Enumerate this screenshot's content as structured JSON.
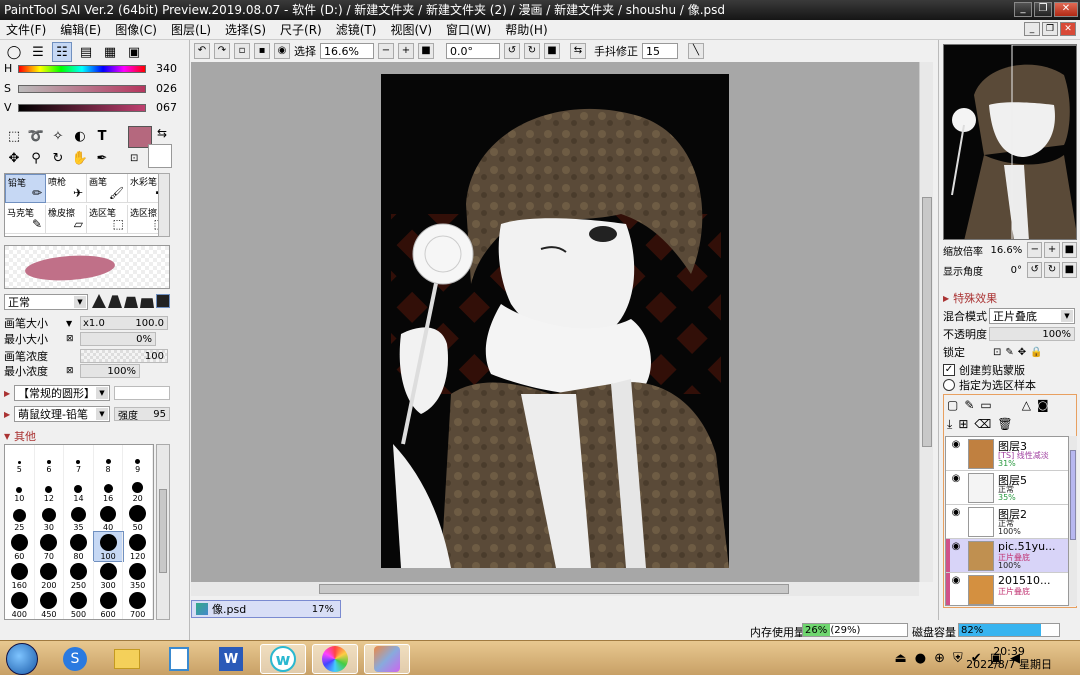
{
  "window": {
    "title": "PaintTool SAI Ver.2 (64bit) Preview.2019.08.07 - 软件 (D:) / 新建文件夹 / 新建文件夹 (2) / 漫画 / 新建文件夹 / shoushu / 像.psd"
  },
  "menu": [
    "文件(F)",
    "编辑(E)",
    "图像(C)",
    "图层(L)",
    "选择(S)",
    "尺子(R)",
    "滤镜(T)",
    "视图(V)",
    "窗口(W)",
    "帮助(H)"
  ],
  "color": {
    "h_label": "H",
    "h_value": "340",
    "s_label": "S",
    "s_value": "026",
    "v_label": "V",
    "v_value": "067",
    "primary": "#b5687e"
  },
  "brushes": [
    {
      "label": "铅笔",
      "icon": "pencil-icon",
      "selected": true
    },
    {
      "label": "喷枪",
      "icon": "airbrush-icon"
    },
    {
      "label": "画笔",
      "icon": "brush-icon"
    },
    {
      "label": "水彩笔",
      "icon": "watercolor-icon"
    },
    {
      "label": "马克笔",
      "icon": "marker-icon"
    },
    {
      "label": "橡皮擦",
      "icon": "eraser-icon"
    },
    {
      "label": "选区笔",
      "icon": "selection-pen-icon"
    },
    {
      "label": "选区擦",
      "icon": "selection-eraser-icon"
    }
  ],
  "brush_settings": {
    "blend_mode": "正常",
    "size_label": "画笔大小",
    "size_mult": "x1.0",
    "size_value": "100.0",
    "min_size_label": "最小大小",
    "min_size_value": "0%",
    "density_label": "画笔浓度",
    "density_value": "100",
    "min_density_label": "最小浓度",
    "min_density_value": "100%",
    "shape_label": "【常规的圆形】",
    "texture_label": "萌鼠纹理-铅笔",
    "strength_label": "强度",
    "strength_value": "95",
    "other_label": "其他"
  },
  "size_presets": [
    {
      "v": "5",
      "d": 3
    },
    {
      "v": "6",
      "d": 4
    },
    {
      "v": "7",
      "d": 4
    },
    {
      "v": "8",
      "d": 5
    },
    {
      "v": "9",
      "d": 5
    },
    {
      "v": "10",
      "d": 6
    },
    {
      "v": "12",
      "d": 7
    },
    {
      "v": "14",
      "d": 8
    },
    {
      "v": "16",
      "d": 9
    },
    {
      "v": "20",
      "d": 11
    },
    {
      "v": "25",
      "d": 13
    },
    {
      "v": "30",
      "d": 14
    },
    {
      "v": "35",
      "d": 15
    },
    {
      "v": "40",
      "d": 16
    },
    {
      "v": "50",
      "d": 17
    },
    {
      "v": "60",
      "d": 17
    },
    {
      "v": "70",
      "d": 17
    },
    {
      "v": "80",
      "d": 17
    },
    {
      "v": "100",
      "d": 17,
      "sel": true
    },
    {
      "v": "120",
      "d": 17
    },
    {
      "v": "160",
      "d": 17
    },
    {
      "v": "200",
      "d": 17
    },
    {
      "v": "250",
      "d": 17
    },
    {
      "v": "300",
      "d": 17
    },
    {
      "v": "350",
      "d": 17
    },
    {
      "v": "400",
      "d": 17
    },
    {
      "v": "450",
      "d": 17
    },
    {
      "v": "500",
      "d": 17
    },
    {
      "v": "600",
      "d": 17
    },
    {
      "v": "700",
      "d": 17
    }
  ],
  "canvas_toolbar": {
    "select_label": "选择",
    "zoom": "16.6%",
    "angle": "0.0°",
    "stabilizer_label": "手抖修正",
    "stabilizer_value": "15"
  },
  "navigator": {
    "zoom_label": "缩放倍率",
    "zoom_value": "16.6%",
    "angle_label": "显示角度",
    "angle_value": "0°"
  },
  "layer_panel": {
    "effects_label": "特殊效果",
    "blend_label": "混合模式",
    "blend_value": "正片叠底",
    "opacity_label": "不透明度",
    "opacity_value": "100%",
    "lock_label": "锁定",
    "clip_label": "创建剪贴蒙版",
    "select_src_label": "指定为选区样本"
  },
  "layers": [
    {
      "name": "图层3",
      "mode": "[TS] 线性减淡",
      "opacity": "31%",
      "thumb": "#c08040"
    },
    {
      "name": "图层5",
      "mode": "正常",
      "opacity": "35%",
      "thumb": "#f4f4f4"
    },
    {
      "name": "图层2",
      "mode": "正常",
      "opacity": "100%",
      "thumb": "#ffffff"
    },
    {
      "name": "pic.51yu...",
      "mode": "正片叠底",
      "opacity": "100%",
      "thumb": "#c09050",
      "sel": true
    },
    {
      "name": "201510...",
      "mode": "正片叠底",
      "opacity": "",
      "thumb": "#d49040"
    }
  ],
  "document_tab": {
    "name": "像.psd",
    "percent": "17%"
  },
  "status": {
    "memory_label": "内存使用量",
    "memory_value": "26% (29%)",
    "memory_pct": 26,
    "disk_label": "磁盘容量",
    "disk_value": "82%",
    "disk_pct": 82
  },
  "clock": {
    "time": "20:39",
    "date": "2022/8/7 星期日"
  }
}
